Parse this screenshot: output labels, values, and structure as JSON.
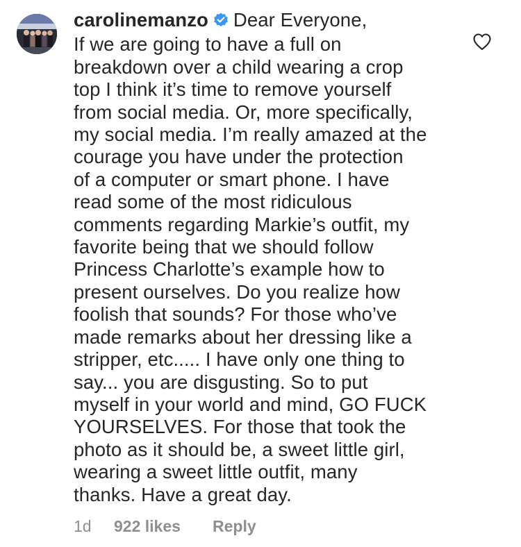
{
  "comment": {
    "username": "carolinemanzo",
    "verified": true,
    "text": "Dear Everyone,\nIf we are going to have a full on\nbreakdown over a child wearing a crop\ntop I think it’s time to remove yourself\nfrom social media. Or, more specifically,\nmy social media. I’m really amazed at the\ncourage you have under the protection\nof a computer or smart phone.  I have\nread some of the most ridiculous\ncomments regarding Markie’s outfit, my\nfavorite being that we should follow\nPrincess Charlotte’s example how to\npresent ourselves. Do you realize how\nfoolish that sounds? For those who’ve\nmade remarks about her dressing like a\nstripper, etc..... I have only one thing to\nsay... you are disgusting. So to put\nmyself in your world and mind, GO FUCK\nYOURSELVES. For those that took the\nphoto as it should be, a sweet little girl,\nwearing a sweet little outfit, many\nthanks.  Have a great day.",
    "time": "1d",
    "likes": "922 likes",
    "reply_label": "Reply"
  },
  "icons": {
    "verified": "verified-badge-icon",
    "like": "heart-outline-icon",
    "avatar": "profile-photo"
  },
  "colors": {
    "text": "#262626",
    "secondary": "#8e8e8e",
    "verified": "#3897f0"
  }
}
